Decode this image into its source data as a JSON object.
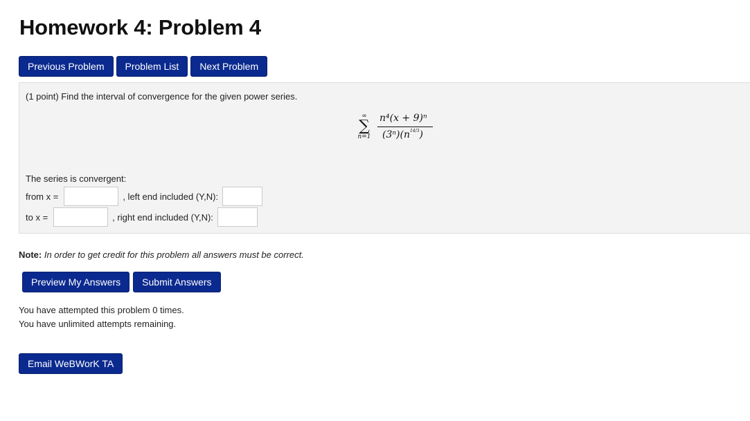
{
  "page_title": "Homework 4: Problem 4",
  "nav": {
    "previous": "Previous Problem",
    "list": "Problem List",
    "next": "Next Problem"
  },
  "problem": {
    "prompt": "(1 point) Find the interval of convergence for the given power series.",
    "formula": {
      "sum_upper": "∞",
      "sum_lower": "n=1",
      "numerator": "n⁴(x + 9)ⁿ",
      "denominator_left": "(3ⁿ)(n",
      "exponent_fraction": "14/3",
      "denominator_right": ")"
    },
    "convergent_label": "The series is convergent:",
    "from_label": "from x =",
    "left_end_label": ", left end included (Y,N):",
    "to_label": "to x =",
    "right_end_label": ", right end included (Y,N):"
  },
  "note": {
    "label": "Note:",
    "text": "In order to get credit for this problem all answers must be correct."
  },
  "actions": {
    "preview": "Preview My Answers",
    "submit": "Submit Answers"
  },
  "status": {
    "attempts": "You have attempted this problem 0 times.",
    "remaining": "You have unlimited attempts remaining."
  },
  "email_button": "Email WeBWorK TA",
  "colors": {
    "button_bg": "#0b2a8f",
    "panel_bg": "#f3f3f3"
  }
}
